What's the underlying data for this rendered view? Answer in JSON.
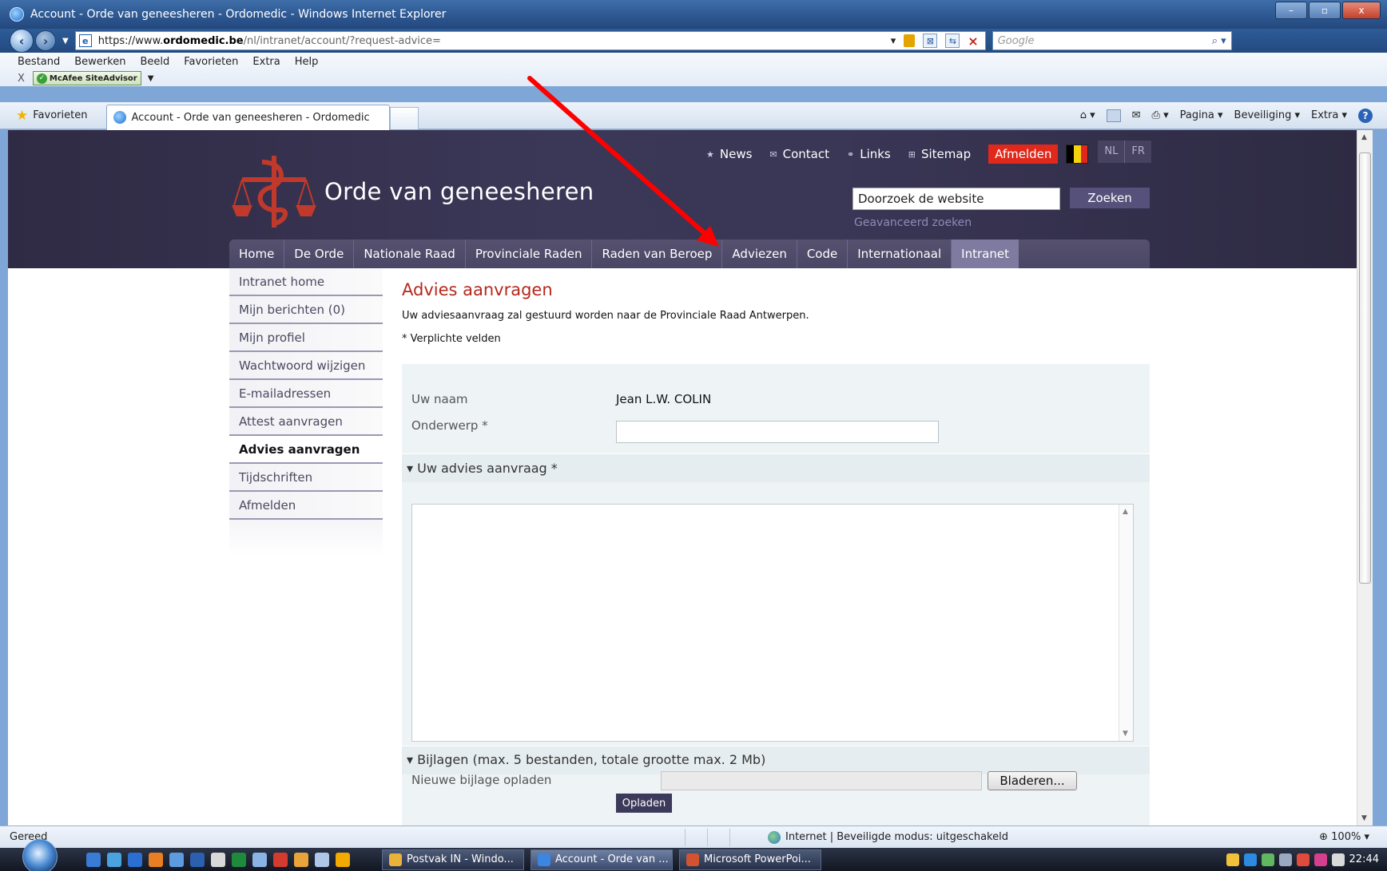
{
  "window": {
    "title": "Account - Orde van geneesheren - Ordomedic - Windows Internet Explorer",
    "controls": [
      "–",
      "▫",
      "x"
    ]
  },
  "address": {
    "url_prefix": "https://www.",
    "url_domain": "ordomedic.be",
    "url_path": "/nl/intranet/account/?request-advice=",
    "search_placeholder": "Google"
  },
  "menu": [
    "Bestand",
    "Bewerken",
    "Beeld",
    "Favorieten",
    "Extra",
    "Help"
  ],
  "addon": {
    "label": "McAfee SiteAdvisor"
  },
  "favbar": {
    "favorites_label": "Favorieten",
    "tab_title": "Account - Orde van geneesheren - Ordomedic",
    "commands": [
      "Pagina ▾",
      "Beveiliging ▾",
      "Extra ▾"
    ]
  },
  "site": {
    "title": "Orde van geneesheren",
    "top_links": [
      "News",
      "Contact",
      "Links",
      "Sitemap"
    ],
    "logout_label": "Afmelden",
    "languages": [
      "NL",
      "FR"
    ],
    "search_value": "Doorzoek de website",
    "search_button": "Zoeken",
    "advanced_search": "Geavanceerd zoeken",
    "main_nav": [
      "Home",
      "De Orde",
      "Nationale Raad",
      "Provinciale Raden",
      "Raden van Beroep",
      "Adviezen",
      "Code",
      "Internationaal",
      "Intranet"
    ],
    "active_nav": "Intranet",
    "flag_colors": [
      "#000000",
      "#f6d40c",
      "#e0281b"
    ]
  },
  "sidebar": {
    "items": [
      "Intranet home",
      "Mijn berichten (0)",
      "Mijn profiel",
      "Wachtwoord wijzigen",
      "E-mailadressen",
      "Attest aanvragen",
      "Advies aanvragen",
      "Tijdschriften",
      "Afmelden"
    ],
    "active": "Advies aanvragen"
  },
  "content": {
    "heading": "Advies aanvragen",
    "intro": "Uw adviesaanvraag zal gestuurd worden naar de Provinciale Raad Antwerpen.",
    "required_note": "* Verplichte velden",
    "name_label": "Uw naam",
    "name_value": "Jean L.W. COLIN",
    "subject_label": "Onderwerp *",
    "subject_value": "",
    "advice_section": "▾ Uw advies aanvraag *",
    "advice_value": "",
    "attachments_section": "▾ Bijlagen (max. 5 bestanden, totale grootte max. 2 Mb)",
    "upload_label": "Nieuwe bijlage opladen",
    "browse_button": "Bladeren...",
    "upload_button": "Opladen"
  },
  "status": {
    "text": "Gereed",
    "zone": "Internet | Beveiligde modus: uitgeschakeld",
    "zoom": "100%"
  },
  "taskbar": {
    "buttons": [
      "Postvak IN - Windo...",
      "Account - Orde van ...",
      "Microsoft PowerPoi..."
    ],
    "active_button": "Account - Orde van ...",
    "clock": "22:44"
  },
  "colors": {
    "accent_red": "#b5281c",
    "header_purple": "#3b3757",
    "annotation_arrow": "#ff0000"
  }
}
